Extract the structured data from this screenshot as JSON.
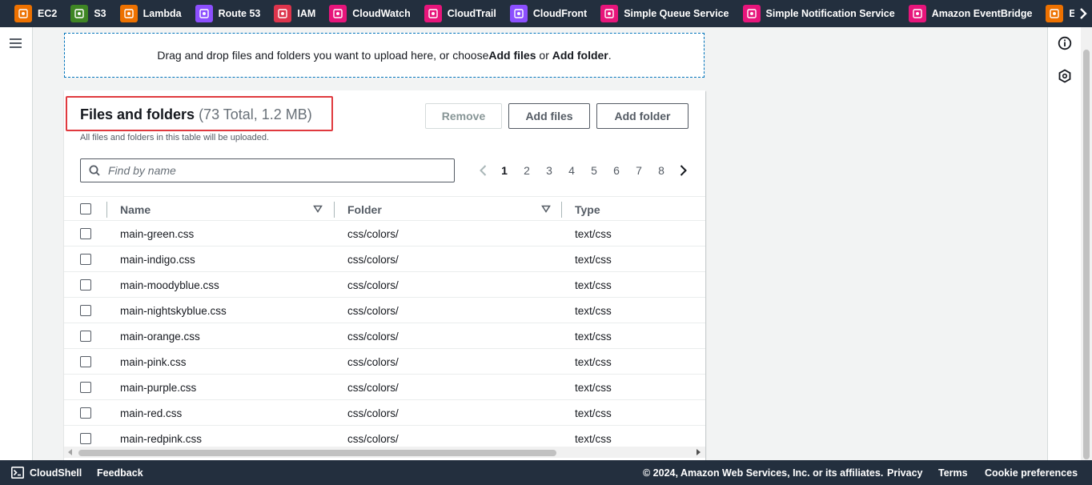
{
  "favorites": [
    {
      "label": "EC2",
      "color": "#ed7100",
      "icon": "ec2-icon"
    },
    {
      "label": "S3",
      "color": "#3f8624",
      "icon": "s3-icon"
    },
    {
      "label": "Lambda",
      "color": "#ed7100",
      "icon": "lambda-icon"
    },
    {
      "label": "Route 53",
      "color": "#8c4fff",
      "icon": "route53-icon"
    },
    {
      "label": "IAM",
      "color": "#dd344c",
      "icon": "iam-icon"
    },
    {
      "label": "CloudWatch",
      "color": "#e7157b",
      "icon": "cloudwatch-icon"
    },
    {
      "label": "CloudTrail",
      "color": "#e7157b",
      "icon": "cloudtrail-icon"
    },
    {
      "label": "CloudFront",
      "color": "#8c4fff",
      "icon": "cloudfront-icon"
    },
    {
      "label": "Simple Queue Service",
      "color": "#e7157b",
      "icon": "sqs-icon"
    },
    {
      "label": "Simple Notification Service",
      "color": "#e7157b",
      "icon": "sns-icon"
    },
    {
      "label": "Amazon EventBridge",
      "color": "#e7157b",
      "icon": "eventbridge-icon"
    },
    {
      "label": "Elastic Beans",
      "color": "#ed7100",
      "icon": "elastic-beanstalk-icon"
    }
  ],
  "dropzone": {
    "prefix": "Drag and drop files and folders you want to upload here, or choose ",
    "add_files": "Add files",
    "or": " or ",
    "add_folder": "Add folder",
    "suffix": "."
  },
  "panel": {
    "title": "Files and folders",
    "counter": "(73 Total, 1.2 MB)",
    "description": "All files and folders in this table will be uploaded.",
    "remove_label": "Remove",
    "add_files_label": "Add files",
    "add_folder_label": "Add folder",
    "search_placeholder": "Find by name"
  },
  "pagination": {
    "pages": [
      "1",
      "2",
      "3",
      "4",
      "5",
      "6",
      "7",
      "8"
    ],
    "current": "1"
  },
  "table": {
    "columns": {
      "name": "Name",
      "folder": "Folder",
      "type": "Type"
    },
    "rows": [
      {
        "name": "main-green.css",
        "folder": "css/colors/",
        "type": "text/css"
      },
      {
        "name": "main-indigo.css",
        "folder": "css/colors/",
        "type": "text/css"
      },
      {
        "name": "main-moodyblue.css",
        "folder": "css/colors/",
        "type": "text/css"
      },
      {
        "name": "main-nightskyblue.css",
        "folder": "css/colors/",
        "type": "text/css"
      },
      {
        "name": "main-orange.css",
        "folder": "css/colors/",
        "type": "text/css"
      },
      {
        "name": "main-pink.css",
        "folder": "css/colors/",
        "type": "text/css"
      },
      {
        "name": "main-purple.css",
        "folder": "css/colors/",
        "type": "text/css"
      },
      {
        "name": "main-red.css",
        "folder": "css/colors/",
        "type": "text/css"
      },
      {
        "name": "main-redpink.css",
        "folder": "css/colors/",
        "type": "text/css"
      }
    ]
  },
  "footer": {
    "cloudshell": "CloudShell",
    "feedback": "Feedback",
    "copyright": "© 2024, Amazon Web Services, Inc. or its affiliates.",
    "privacy": "Privacy",
    "terms": "Terms",
    "cookie": "Cookie preferences"
  }
}
